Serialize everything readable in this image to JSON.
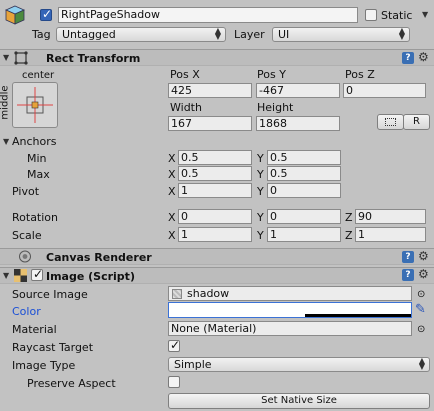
{
  "header": {
    "name": "RightPageShadow",
    "active": true,
    "static_label": "Static",
    "tag_label": "Tag",
    "tag_value": "Untagged",
    "layer_label": "Layer",
    "layer_value": "UI"
  },
  "rect_transform": {
    "title": "Rect Transform",
    "anchor_preset_top": "center",
    "anchor_preset_side": "middle",
    "pos_x_label": "Pos X",
    "pos_y_label": "Pos Y",
    "pos_z_label": "Pos Z",
    "pos_x": "425",
    "pos_y": "-467",
    "pos_z": "0",
    "width_label": "Width",
    "height_label": "Height",
    "width": "167",
    "height": "1868",
    "raw_button": "R",
    "anchors_label": "Anchors",
    "min_label": "Min",
    "max_label": "Max",
    "min_x": "0.5",
    "min_y": "0.5",
    "max_x": "0.5",
    "max_y": "0.5",
    "pivot_label": "Pivot",
    "pivot_x": "1",
    "pivot_y": "0",
    "rotation_label": "Rotation",
    "rot_x": "0",
    "rot_y": "0",
    "rot_z": "90",
    "scale_label": "Scale",
    "scale_x": "1",
    "scale_y": "1",
    "scale_z": "1",
    "x": "X",
    "y": "Y",
    "z": "Z"
  },
  "canvas_renderer": {
    "title": "Canvas Renderer"
  },
  "image": {
    "title": "Image (Script)",
    "enabled": true,
    "source_image_label": "Source Image",
    "source_image_value": "shadow",
    "color_label": "Color",
    "material_label": "Material",
    "material_value": "None (Material)",
    "raycast_label": "Raycast Target",
    "raycast": true,
    "image_type_label": "Image Type",
    "image_type_value": "Simple",
    "preserve_aspect_label": "Preserve Aspect",
    "preserve_aspect": false,
    "set_native_size": "Set Native Size"
  },
  "colors": {
    "label_blue": "#1a4fd6",
    "panel_bg": "#c2c2c2",
    "header_bg": "#bcbcbc"
  }
}
